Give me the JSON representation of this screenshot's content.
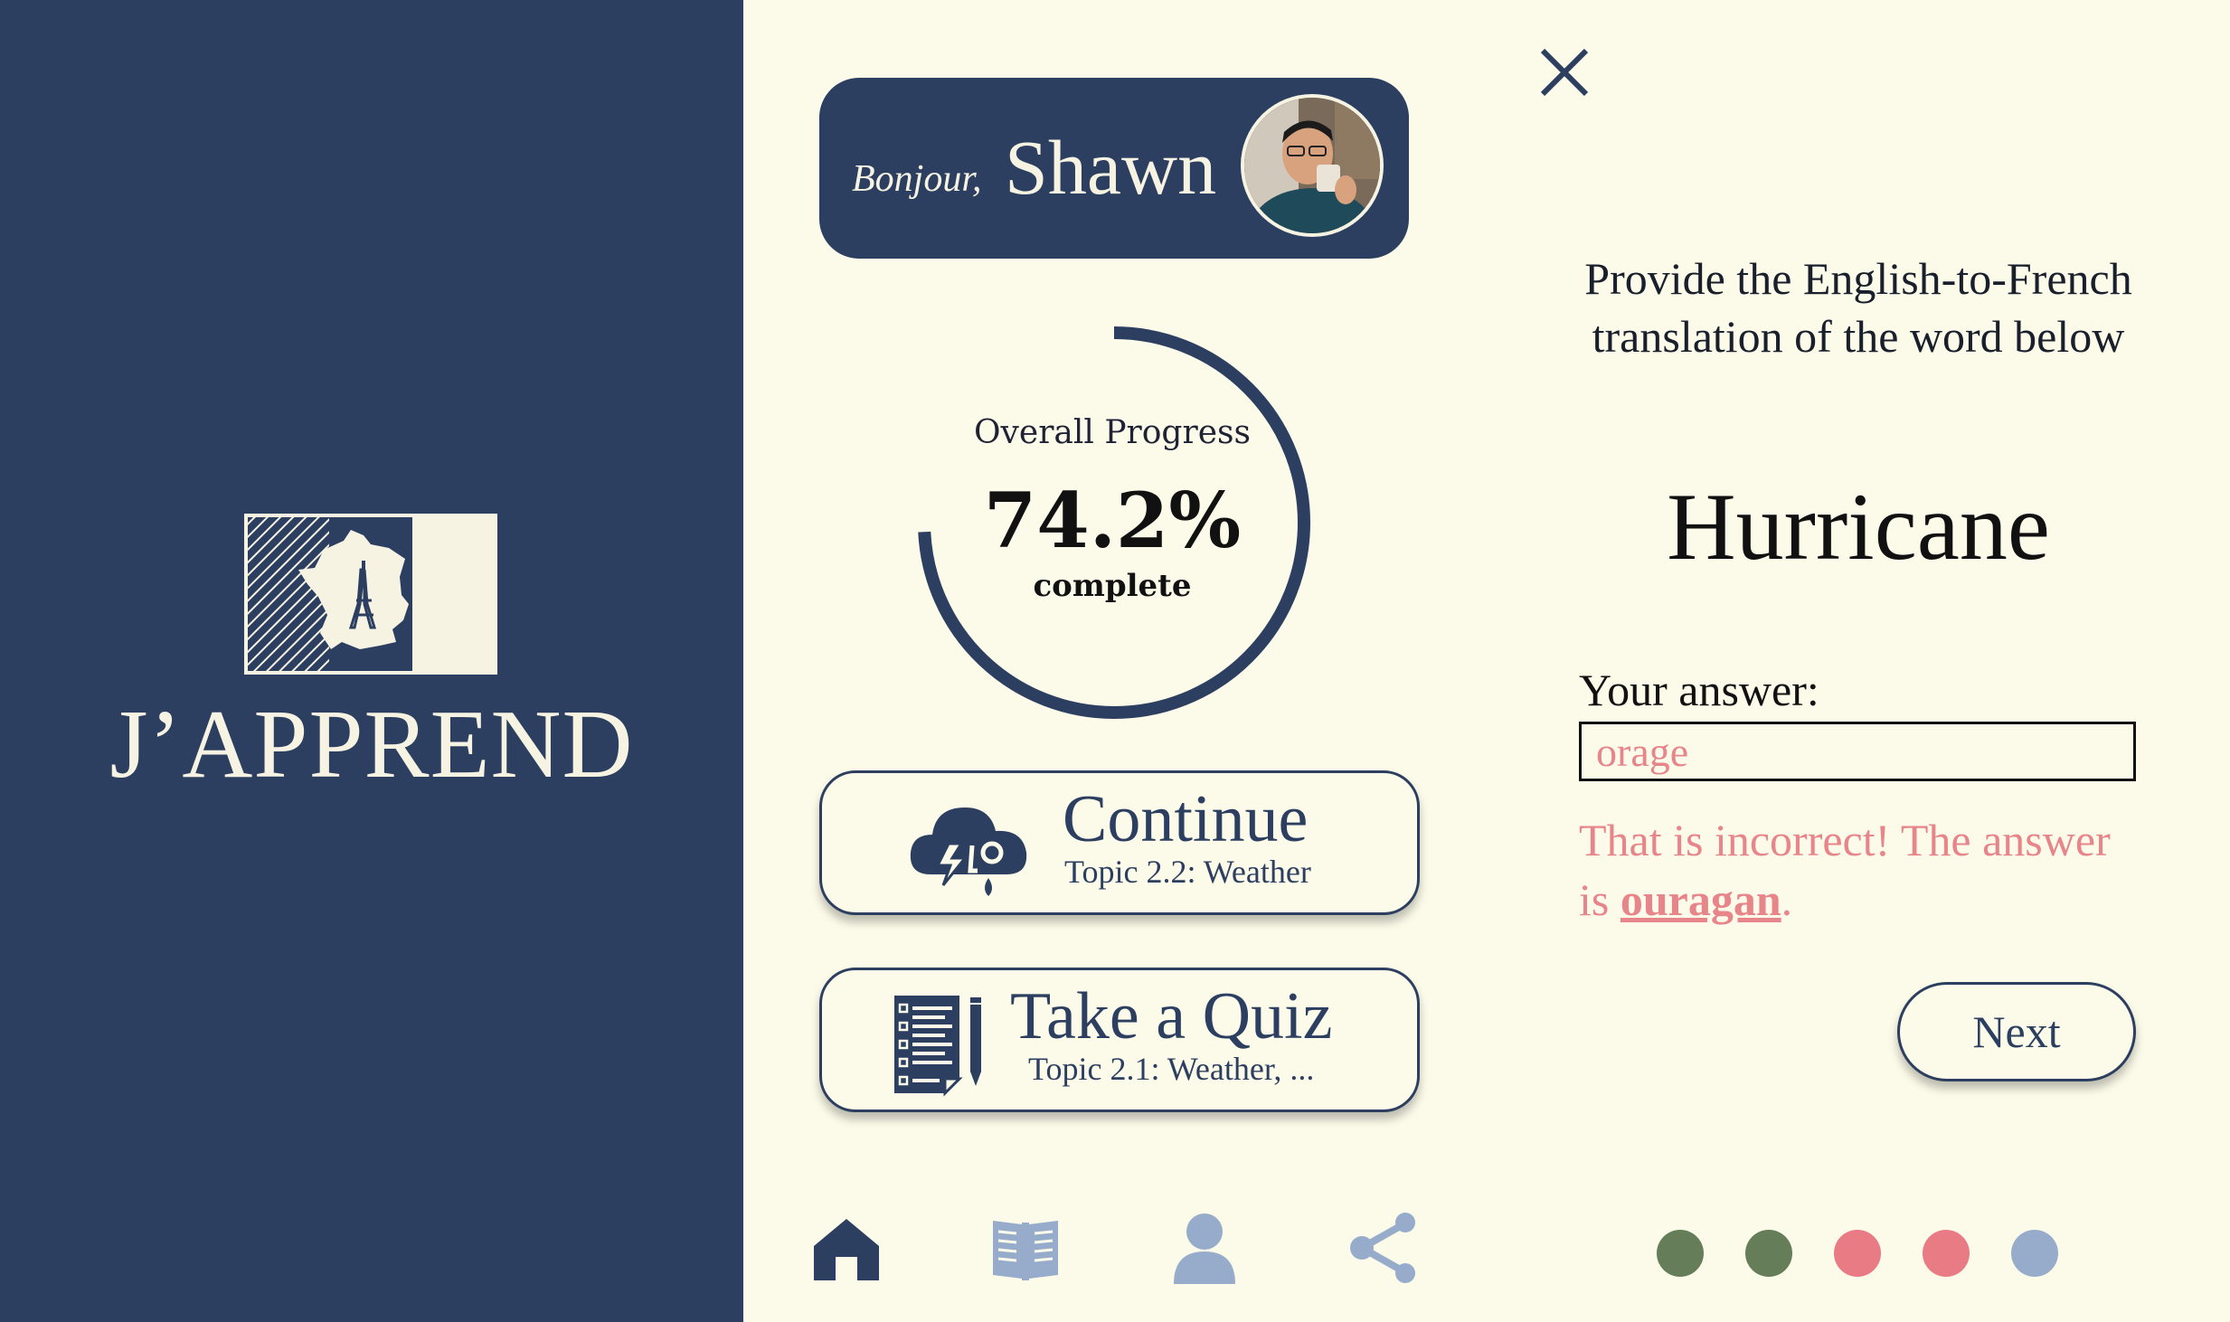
{
  "brand": {
    "name": "J’APPREND"
  },
  "greeting": {
    "hello": "Bonjour,",
    "name": "Shawn"
  },
  "progress": {
    "label": "Overall Progress",
    "value_text": "74.2%",
    "sub": "complete",
    "fraction": 0.742
  },
  "cards": {
    "continue": {
      "title": "Continue",
      "subtitle": "Topic 2.2: Weather",
      "icon": "storm-cloud-icon"
    },
    "quiz": {
      "title": "Take a Quiz",
      "subtitle": "Topic 2.1: Weather, ...",
      "icon": "quiz-list-icon"
    }
  },
  "nav": {
    "items": [
      {
        "icon": "home-icon",
        "active": true
      },
      {
        "icon": "book-icon",
        "active": false
      },
      {
        "icon": "profile-icon",
        "active": false
      },
      {
        "icon": "share-icon",
        "active": false
      }
    ]
  },
  "quiz": {
    "prompt": "Provide the English-to-French translation of the word below",
    "word": "Hurricane",
    "answer_label": "Your answer:",
    "answer_value": "orage",
    "feedback_prefix": "That is incorrect! The answer is ",
    "feedback_answer": "ouragan",
    "feedback_suffix": ".",
    "next_label": "Next",
    "results": [
      "correct",
      "correct",
      "incorrect",
      "incorrect",
      "pending"
    ]
  },
  "colors": {
    "navy": "#2C3F60",
    "cream": "#FCFBE9",
    "correct": "#657E59",
    "incorrect": "#E87B84",
    "pending": "#97ACCB",
    "nav_inactive": "#97ACCB"
  }
}
